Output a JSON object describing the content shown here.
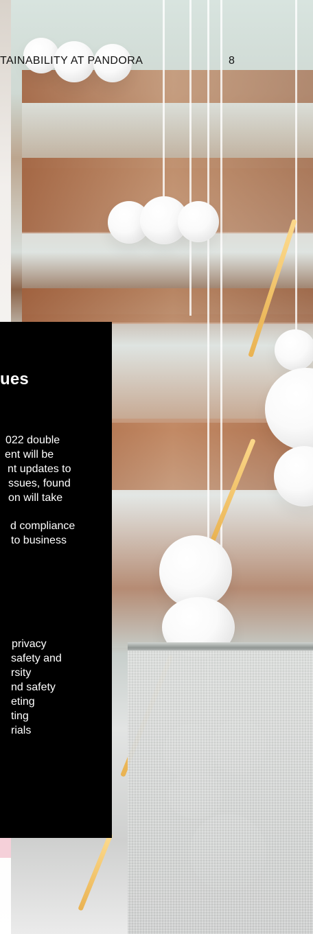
{
  "header": {
    "title": "TAINABILITY AT PANDORA",
    "page_number": "8"
  },
  "panel": {
    "title": "ues",
    "paragraph_1_lines": [
      "022 double",
      "ent will be",
      "nt updates to",
      "ssues, found",
      "on will take"
    ],
    "paragraph_2_lines": [
      "d compliance",
      "to business"
    ],
    "paragraph_3_lines": [
      "privacy",
      "safety and",
      "",
      "rsity",
      "",
      "nd safety",
      "eting",
      "ting",
      "rials"
    ]
  }
}
